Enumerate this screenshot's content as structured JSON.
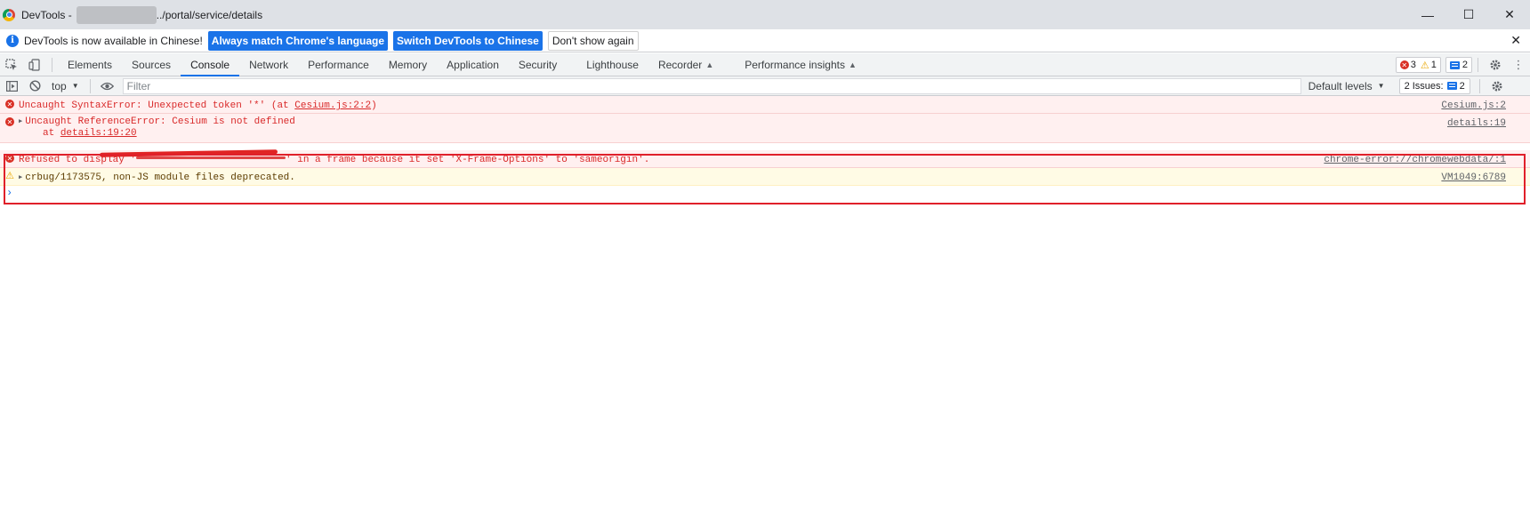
{
  "titlebar": {
    "app_name": "DevTools -",
    "path": "../portal/service/details",
    "minimize_icon": "minimize-icon",
    "maximize_icon": "maximize-icon",
    "close_icon": "close-icon"
  },
  "infobar": {
    "message": "DevTools is now available in Chinese!",
    "btn_match": "Always match Chrome's language",
    "btn_switch": "Switch DevTools to Chinese",
    "btn_dismiss": "Don't show again"
  },
  "tabs": [
    {
      "label": "Elements"
    },
    {
      "label": "Sources"
    },
    {
      "label": "Console"
    },
    {
      "label": "Network"
    },
    {
      "label": "Performance"
    },
    {
      "label": "Memory"
    },
    {
      "label": "Application"
    },
    {
      "label": "Security"
    },
    {
      "label": "Lighthouse"
    },
    {
      "label": "Recorder"
    },
    {
      "label": "Performance insights"
    }
  ],
  "counts": {
    "errors": "3",
    "warnings": "1",
    "messages": "2"
  },
  "console_toolbar": {
    "context": "top",
    "filter_placeholder": "Filter",
    "levels": "Default levels",
    "issues_label": "2 Issues:",
    "issues_count": "2"
  },
  "messages": [
    {
      "level": "error",
      "text_pre": "Uncaught SyntaxError: Unexpected token '*' (at ",
      "text_link": "Cesium.js:2:2",
      "text_post": ")",
      "source": "Cesium.js:2"
    },
    {
      "level": "error",
      "text": "Uncaught ReferenceError: Cesium is not defined",
      "sub_pre": "at ",
      "sub_link": "details:19:20",
      "source": "details:19"
    },
    {
      "level": "error",
      "text_pre": "Refused to display '",
      "text_post": "' in a frame because it set 'X-Frame-Options' to 'sameorigin'.",
      "source": "chrome-error://chromewebdata/:1"
    },
    {
      "level": "warning",
      "text": "crbug/1173575, non-JS module files deprecated.",
      "source": "VM1049:6789"
    }
  ],
  "prompt": "›",
  "colors": {
    "accent": "#1a73e8",
    "error": "#d93025",
    "warning": "#e8a600",
    "highlight": "#e0202a"
  }
}
